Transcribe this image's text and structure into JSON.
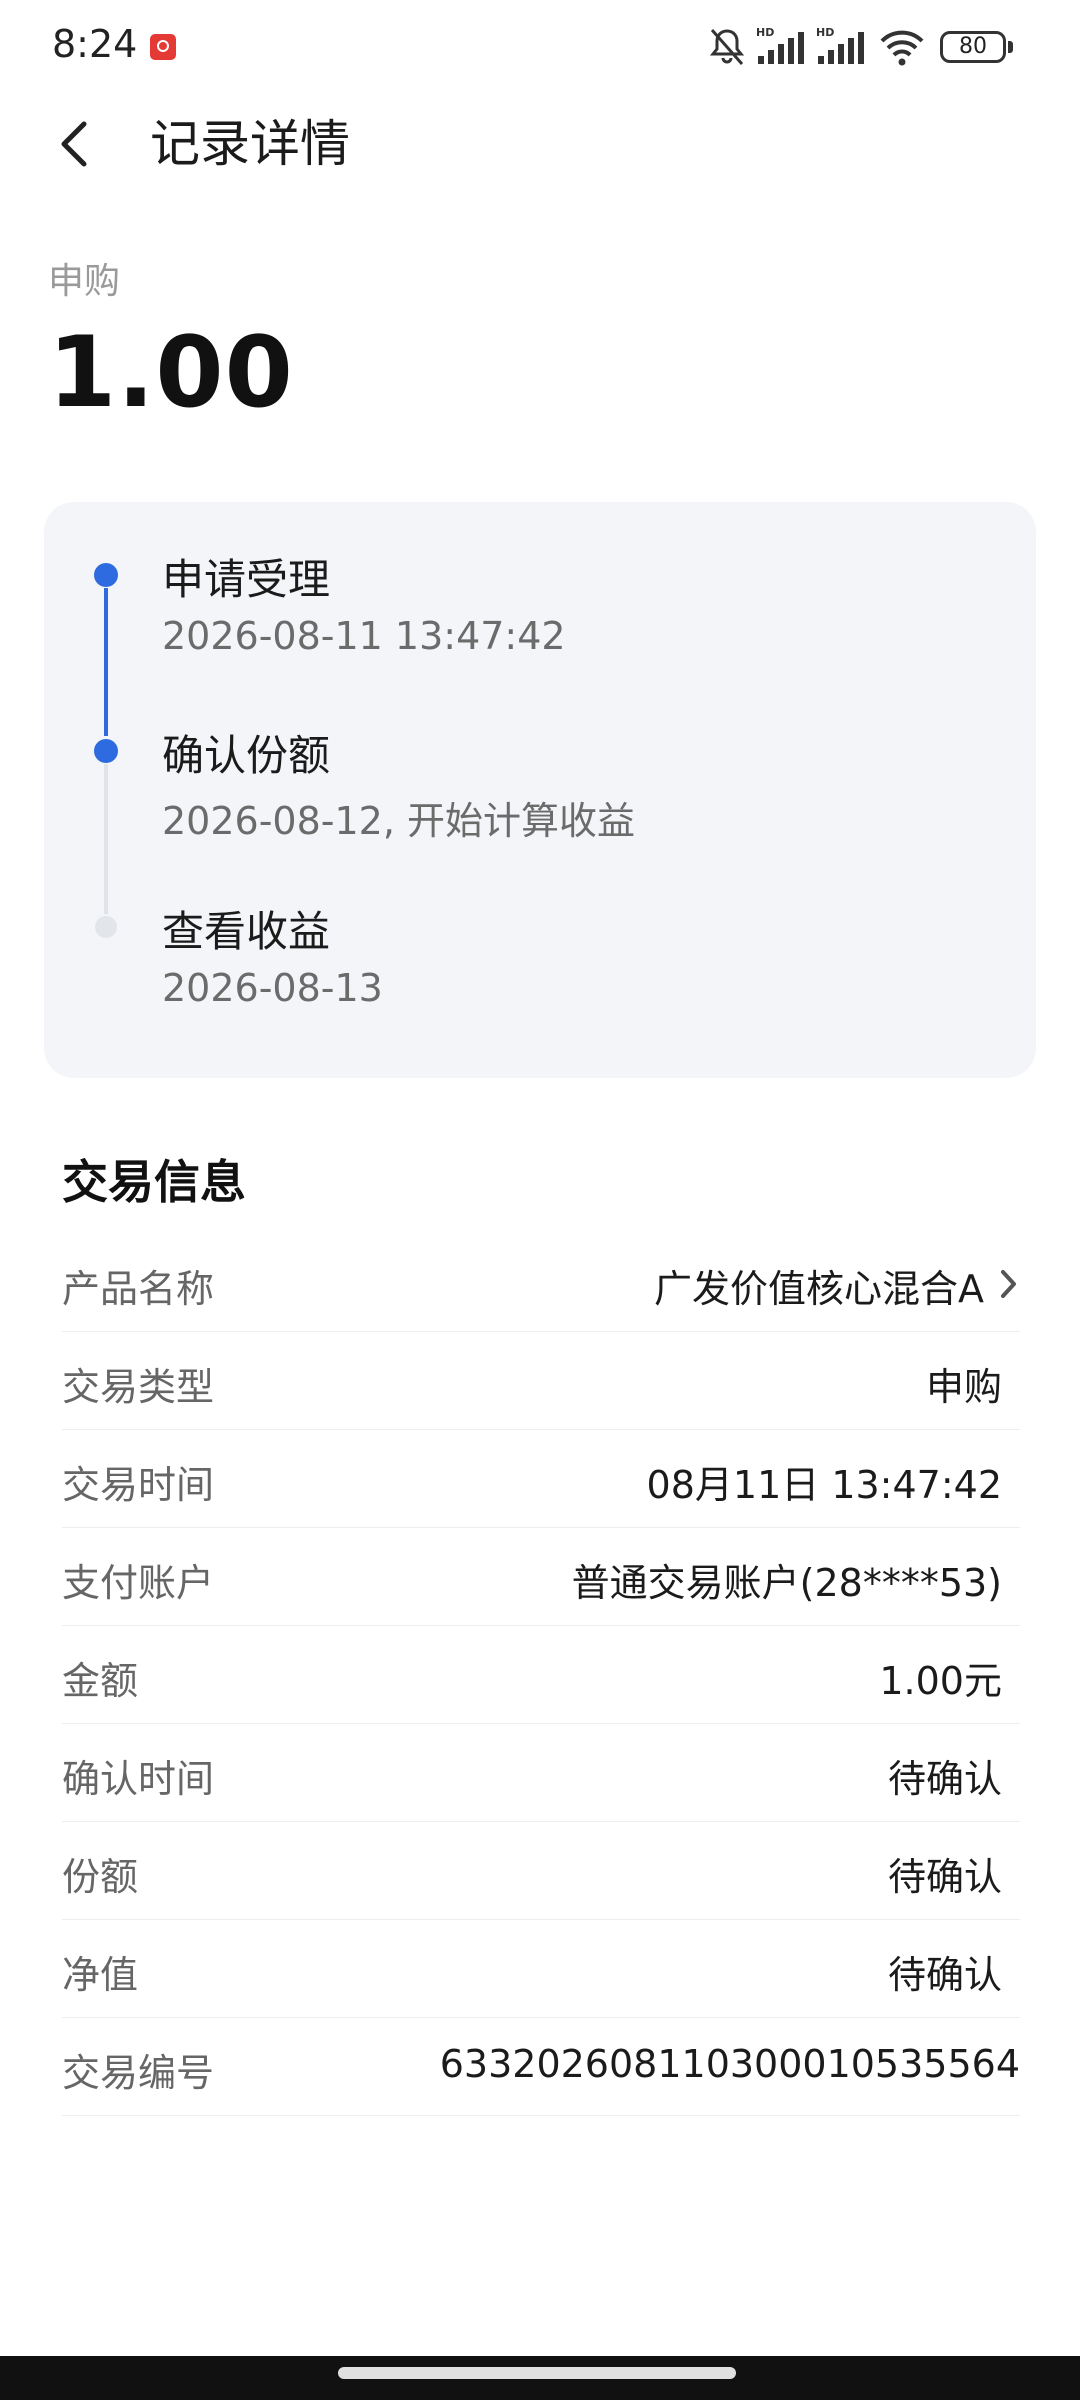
{
  "status_bar": {
    "time": "8:24",
    "battery": "80",
    "icons": [
      "app-notification-icon",
      "mute-icon",
      "hd-signal-icon",
      "hd-signal-icon",
      "wifi-icon",
      "battery-icon"
    ]
  },
  "header": {
    "title": "记录详情",
    "back_icon": "chevron-left-icon"
  },
  "summary": {
    "type": "申购",
    "amount": "1.00"
  },
  "progress": {
    "accent_color": "#2f6be0",
    "steps": [
      {
        "title": "申请受理",
        "subtitle": "2026-08-11 13:47:42",
        "state": "done"
      },
      {
        "title": "确认份额",
        "subtitle": "2026-08-12, 开始计算收益",
        "state": "done"
      },
      {
        "title": "查看收益",
        "subtitle": "2026-08-13",
        "state": "pending"
      }
    ]
  },
  "trade_info": {
    "title": "交易信息",
    "rows": [
      {
        "label": "产品名称",
        "value": "广发价值核心混合A"
      },
      {
        "label": "交易类型",
        "value": "申购"
      },
      {
        "label": "交易时间",
        "value": "08月11日 13:47:42"
      },
      {
        "label": "支付账户",
        "value": "普通交易账户(28****53)"
      },
      {
        "label": "金额",
        "value": "1.00元"
      },
      {
        "label": "确认时间",
        "value": "待确认"
      },
      {
        "label": "份额",
        "value": "待确认"
      },
      {
        "label": "净值",
        "value": "待确认"
      },
      {
        "label": "交易编号",
        "value": "633202608110300010535564"
      }
    ]
  }
}
